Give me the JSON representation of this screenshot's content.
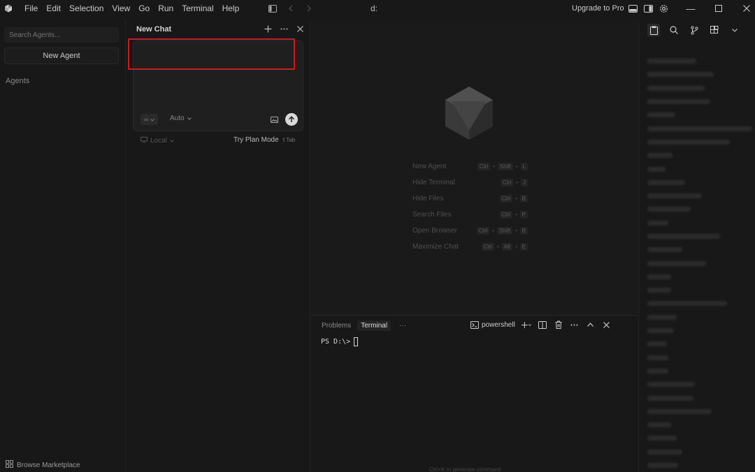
{
  "menu": [
    "File",
    "Edit",
    "Selection",
    "View",
    "Go",
    "Run",
    "Terminal",
    "Help"
  ],
  "window_title": "d:",
  "upgrade_label": "Upgrade to Pro",
  "sidebar": {
    "search_placeholder": "Search Agents...",
    "new_agent_label": "New Agent",
    "agents_label": "Agents",
    "browse_marketplace_label": "Browse Marketplace"
  },
  "chat": {
    "title": "New Chat",
    "input_value": "",
    "model_label": "∞",
    "auto_label": "Auto",
    "local_label": "Local",
    "plan_mode_label": "Try Plan Mode",
    "plan_mode_key": "⇧Tab"
  },
  "shortcuts": [
    {
      "label": "New Agent",
      "keys": [
        "Ctrl",
        "Shift",
        "L"
      ]
    },
    {
      "label": "Hide Terminal",
      "keys": [
        "Ctrl",
        "J"
      ]
    },
    {
      "label": "Hide Files",
      "keys": [
        "Ctrl",
        "B"
      ]
    },
    {
      "label": "Search Files",
      "keys": [
        "Ctrl",
        "P"
      ]
    },
    {
      "label": "Open Browser",
      "keys": [
        "Ctrl",
        "Shift",
        "B"
      ]
    },
    {
      "label": "Maximize Chat",
      "keys": [
        "Ctrl",
        "Alt",
        "E"
      ]
    }
  ],
  "terminal": {
    "tabs": [
      "Problems",
      "Terminal"
    ],
    "active_tab": "Terminal",
    "more_label": "···",
    "shell_name": "powershell",
    "prompt": "PS D:\\>",
    "hint": "Ctrl+K to generate command"
  },
  "colors": {
    "highlight": "#d11a1a",
    "background": "#181818"
  }
}
